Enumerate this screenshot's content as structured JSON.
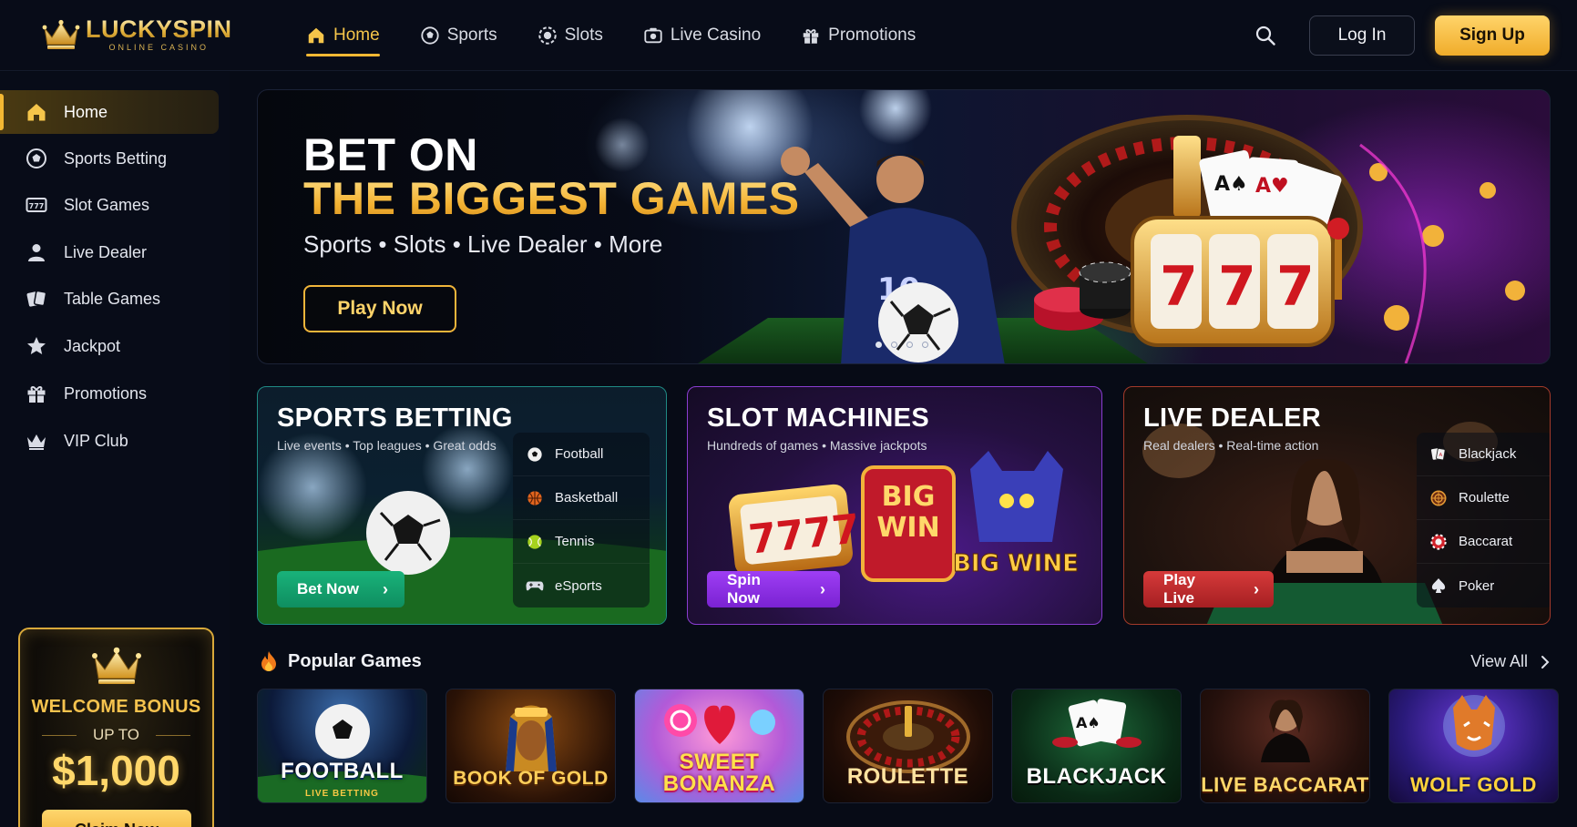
{
  "brand": {
    "name": "LUCKYSPIN",
    "tagline": "ONLINE CASINO"
  },
  "colors": {
    "gold": "#f3b833",
    "background": "#070b16",
    "sports_accent": "#19b27a",
    "slots_accent": "#9e3ef4",
    "live_accent": "#d63a3a"
  },
  "nav": {
    "items": [
      {
        "label": "Home",
        "icon": "home-icon"
      },
      {
        "label": "Sports",
        "icon": "soccer-ball-icon"
      },
      {
        "label": "Slots",
        "icon": "slot-chip-icon"
      },
      {
        "label": "Live Casino",
        "icon": "camera-icon"
      },
      {
        "label": "Promotions",
        "icon": "gift-icon"
      }
    ],
    "active": "Home",
    "login_label": "Log In",
    "signup_label": "Sign Up"
  },
  "sidebar": {
    "items": [
      {
        "label": "Home",
        "icon": "home-icon"
      },
      {
        "label": "Sports Betting",
        "icon": "soccer-ball-icon"
      },
      {
        "label": "Slot Games",
        "icon": "slot-machine-icon"
      },
      {
        "label": "Live Dealer",
        "icon": "person-icon"
      },
      {
        "label": "Table Games",
        "icon": "cards-icon"
      },
      {
        "label": "Jackpot",
        "icon": "star-icon"
      },
      {
        "label": "Promotions",
        "icon": "gift-icon"
      },
      {
        "label": "VIP Club",
        "icon": "crown-icon"
      }
    ],
    "active": "Home",
    "bonus": {
      "title": "WELCOME BONUS",
      "up_to": "UP TO",
      "amount": "$1,000",
      "button": "Claim Now"
    }
  },
  "hero": {
    "title_line1": "BET ON",
    "title_line2": "THE BIGGEST GAMES",
    "subtitle": "Sports • Slots • Live Dealer • More",
    "button": "Play Now",
    "slide_count": 4,
    "active_slide": 1
  },
  "categories": [
    {
      "title": "SPORTS BETTING",
      "description": "Live events • Top leagues • Great odds",
      "button": "Bet Now",
      "items": [
        {
          "label": "Football",
          "icon": "soccer-ball-icon"
        },
        {
          "label": "Basketball",
          "icon": "basketball-icon"
        },
        {
          "label": "Tennis",
          "icon": "tennis-ball-icon"
        },
        {
          "label": "eSports",
          "icon": "gamepad-icon"
        }
      ]
    },
    {
      "title": "SLOT MACHINES",
      "description": "Hundreds of games • Massive jackpots",
      "button": "Spin Now",
      "art_text": {
        "big_win": "BIG WIN",
        "big_wine": "BIG WINE",
        "reels": "7777"
      }
    },
    {
      "title": "LIVE DEALER",
      "description": "Real dealers • Real-time action",
      "button": "Play Live",
      "items": [
        {
          "label": "Blackjack",
          "icon": "cards-icon"
        },
        {
          "label": "Roulette",
          "icon": "roulette-icon"
        },
        {
          "label": "Baccarat",
          "icon": "chip-icon"
        },
        {
          "label": "Poker",
          "icon": "spade-icon"
        }
      ]
    }
  ],
  "popular": {
    "title": "Popular Games",
    "view_all": "View All",
    "games": [
      {
        "title": "FOOTBALL",
        "subtitle": "LIVE BETTING"
      },
      {
        "title": "BOOK OF GOLD"
      },
      {
        "title": "SWEET BONANZA"
      },
      {
        "title": "ROULETTE"
      },
      {
        "title": "BLACKJACK"
      },
      {
        "title": "LIVE BACCARAT"
      },
      {
        "title": "WOLF GOLD"
      }
    ]
  }
}
